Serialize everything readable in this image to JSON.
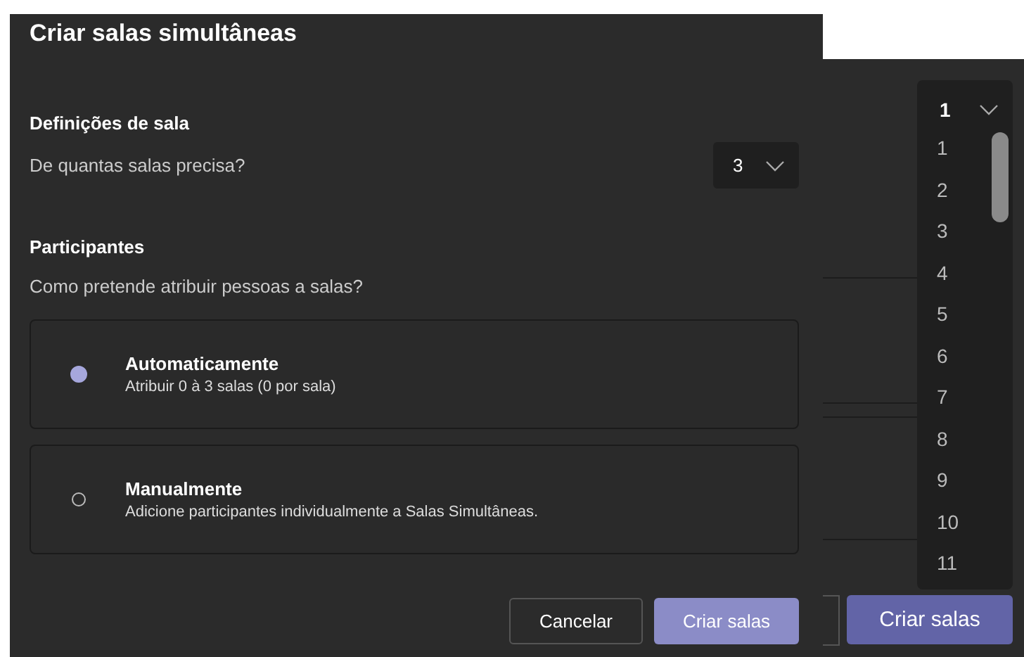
{
  "dialog": {
    "title": "Criar salas simultâneas",
    "room_settings": {
      "heading": "Definições de sala",
      "question": "De quantas salas precisa?",
      "count_select": {
        "value": "3"
      }
    },
    "participants": {
      "heading": "Participantes",
      "question": "Como pretende atribuir pessoas a salas?",
      "options": [
        {
          "title": "Automaticamente",
          "description": "Atribuir 0 à 3 salas (0 por sala)",
          "selected": true
        },
        {
          "title": "Manualmente",
          "description": "Adicione participantes individualmente a Salas Simultâneas.",
          "selected": false
        }
      ]
    },
    "buttons": [
      {
        "label": "Cancelar",
        "kind": "secondary"
      },
      {
        "label": "Criar salas",
        "kind": "primary"
      }
    ]
  },
  "background_dialog": {
    "dropdown": {
      "value": "1",
      "options": [
        {
          "label": "1"
        },
        {
          "label": "2"
        },
        {
          "label": "3"
        },
        {
          "label": "4"
        },
        {
          "label": "5"
        },
        {
          "label": "6"
        },
        {
          "label": "7"
        },
        {
          "label": "8"
        },
        {
          "label": "9"
        },
        {
          "label": "10"
        },
        {
          "label": "11"
        }
      ]
    },
    "button": {
      "label": "Criar salas"
    }
  }
}
